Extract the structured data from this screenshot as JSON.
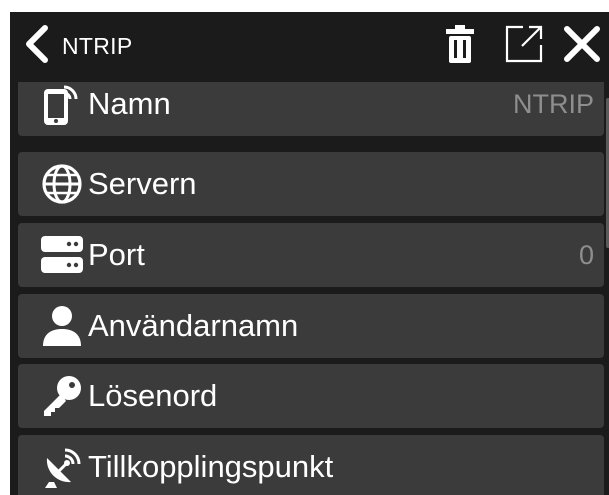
{
  "header": {
    "title": "NTRIP",
    "icons": {
      "back": "chevron-left-icon",
      "delete": "trash-icon",
      "open": "open-external-icon",
      "close": "close-icon"
    }
  },
  "rows": [
    {
      "label": "Namn",
      "value": "NTRIP",
      "icon": "phone-broadcast-icon"
    },
    {
      "label": "Servern",
      "value": "",
      "icon": "globe-icon"
    },
    {
      "label": "Port",
      "value": "0",
      "icon": "server-icon"
    },
    {
      "label": "Användarnamn",
      "value": "",
      "icon": "user-icon"
    },
    {
      "label": "Lösenord",
      "value": "",
      "icon": "key-icon"
    },
    {
      "label": "Tillkopplingspunkt",
      "value": "",
      "icon": "satellite-dish-icon"
    }
  ],
  "colors": {
    "background": "#1b1b1b",
    "row": "#3b3b3b",
    "text": "#ffffff",
    "value_text": "#8e8e8e"
  }
}
